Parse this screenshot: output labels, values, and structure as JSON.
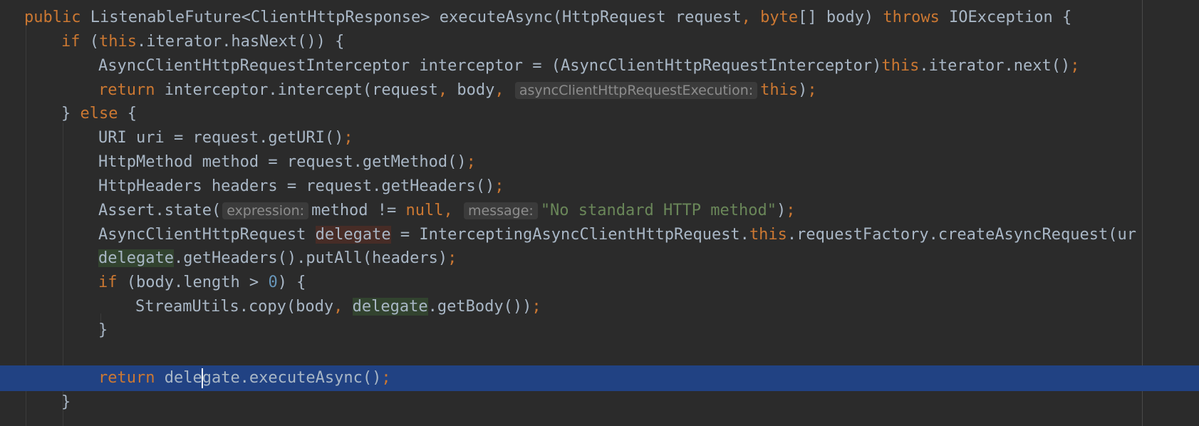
{
  "editor": {
    "language": "Java",
    "caret_line": 15,
    "lines": [
      {
        "tokens": [
          {
            "t": "public ",
            "c": "kw"
          },
          {
            "t": "ListenableFuture<ClientHttpResponse> executeAsync(HttpRequest request",
            "c": "tx"
          },
          {
            "t": ", ",
            "c": "pn"
          },
          {
            "t": "byte",
            "c": "kw"
          },
          {
            "t": "[] body) ",
            "c": "tx"
          },
          {
            "t": "throws ",
            "c": "kw"
          },
          {
            "t": "IOException {",
            "c": "tx"
          }
        ]
      },
      {
        "tokens": [
          {
            "t": "if ",
            "c": "kw"
          },
          {
            "t": "(",
            "c": "tx"
          },
          {
            "t": "this",
            "c": "kw"
          },
          {
            "t": ".iterator.hasNext()) {",
            "c": "tx"
          }
        ]
      },
      {
        "tokens": [
          {
            "t": "AsyncClientHttpRequestInterceptor interceptor = (AsyncClientHttpRequestInterceptor)",
            "c": "tx"
          },
          {
            "t": "this",
            "c": "kw"
          },
          {
            "t": ".iterator.next()",
            "c": "tx"
          },
          {
            "t": ";",
            "c": "pn"
          }
        ]
      },
      {
        "tokens": [
          {
            "t": "return ",
            "c": "kw"
          },
          {
            "t": "interceptor.intercept(request",
            "c": "tx"
          },
          {
            "t": ", ",
            "c": "pn"
          },
          {
            "t": "body",
            "c": "tx"
          },
          {
            "t": ", ",
            "c": "pn"
          },
          {
            "t": "asyncClientHttpRequestExecution:",
            "c": "hint"
          },
          {
            "t": "this",
            "c": "kw"
          },
          {
            "t": ")",
            "c": "tx"
          },
          {
            "t": ";",
            "c": "pn"
          }
        ]
      },
      {
        "tokens": [
          {
            "t": "} ",
            "c": "tx"
          },
          {
            "t": "else ",
            "c": "kw"
          },
          {
            "t": "{",
            "c": "tx"
          }
        ]
      },
      {
        "tokens": [
          {
            "t": "URI uri = request.getURI()",
            "c": "tx"
          },
          {
            "t": ";",
            "c": "pn"
          }
        ]
      },
      {
        "tokens": [
          {
            "t": "HttpMethod method = request.getMethod()",
            "c": "tx"
          },
          {
            "t": ";",
            "c": "pn"
          }
        ]
      },
      {
        "tokens": [
          {
            "t": "HttpHeaders headers = request.getHeaders()",
            "c": "tx"
          },
          {
            "t": ";",
            "c": "pn"
          }
        ]
      },
      {
        "tokens": [
          {
            "t": "Assert.state(",
            "c": "tx"
          },
          {
            "t": "expression:",
            "c": "hint"
          },
          {
            "t": "method != ",
            "c": "tx"
          },
          {
            "t": "null",
            "c": "kw"
          },
          {
            "t": ", ",
            "c": "pn"
          },
          {
            "t": "message:",
            "c": "hint"
          },
          {
            "t": "\"No standard HTTP method\"",
            "c": "str"
          },
          {
            "t": ")",
            "c": "tx"
          },
          {
            "t": ";",
            "c": "pn"
          }
        ]
      },
      {
        "tokens": [
          {
            "t": "AsyncClientHttpRequest ",
            "c": "tx"
          },
          {
            "t": "delegate",
            "c": "hl-write"
          },
          {
            "t": " = InterceptingAsyncClientHttpRequest.",
            "c": "tx"
          },
          {
            "t": "this",
            "c": "kw"
          },
          {
            "t": ".requestFactory.createAsyncRequest(ur",
            "c": "tx"
          }
        ]
      },
      {
        "tokens": [
          {
            "t": "delegate",
            "c": "hl-read"
          },
          {
            "t": ".getHeaders().putAll(headers)",
            "c": "tx"
          },
          {
            "t": ";",
            "c": "pn"
          }
        ]
      },
      {
        "tokens": [
          {
            "t": "if ",
            "c": "kw"
          },
          {
            "t": "(body.length > ",
            "c": "tx"
          },
          {
            "t": "0",
            "c": "num"
          },
          {
            "t": ") {",
            "c": "tx"
          }
        ]
      },
      {
        "tokens": [
          {
            "t": "StreamUtils.copy(body",
            "c": "tx"
          },
          {
            "t": ", ",
            "c": "pn"
          },
          {
            "t": "delegate",
            "c": "hl-read"
          },
          {
            "t": ".getBody())",
            "c": "tx"
          },
          {
            "t": ";",
            "c": "pn"
          }
        ]
      },
      {
        "tokens": [
          {
            "t": "}",
            "c": "tx"
          }
        ]
      },
      {
        "tokens": []
      },
      {
        "tokens": [
          {
            "t": "return ",
            "c": "kw"
          },
          {
            "t": "dele",
            "c": "tx"
          },
          {
            "t": "",
            "c": "caret"
          },
          {
            "t": "gate.executeAsync()",
            "c": "tx"
          },
          {
            "t": ";",
            "c": "pn"
          }
        ]
      },
      {
        "tokens": [
          {
            "t": "}",
            "c": "tx"
          }
        ]
      }
    ]
  }
}
